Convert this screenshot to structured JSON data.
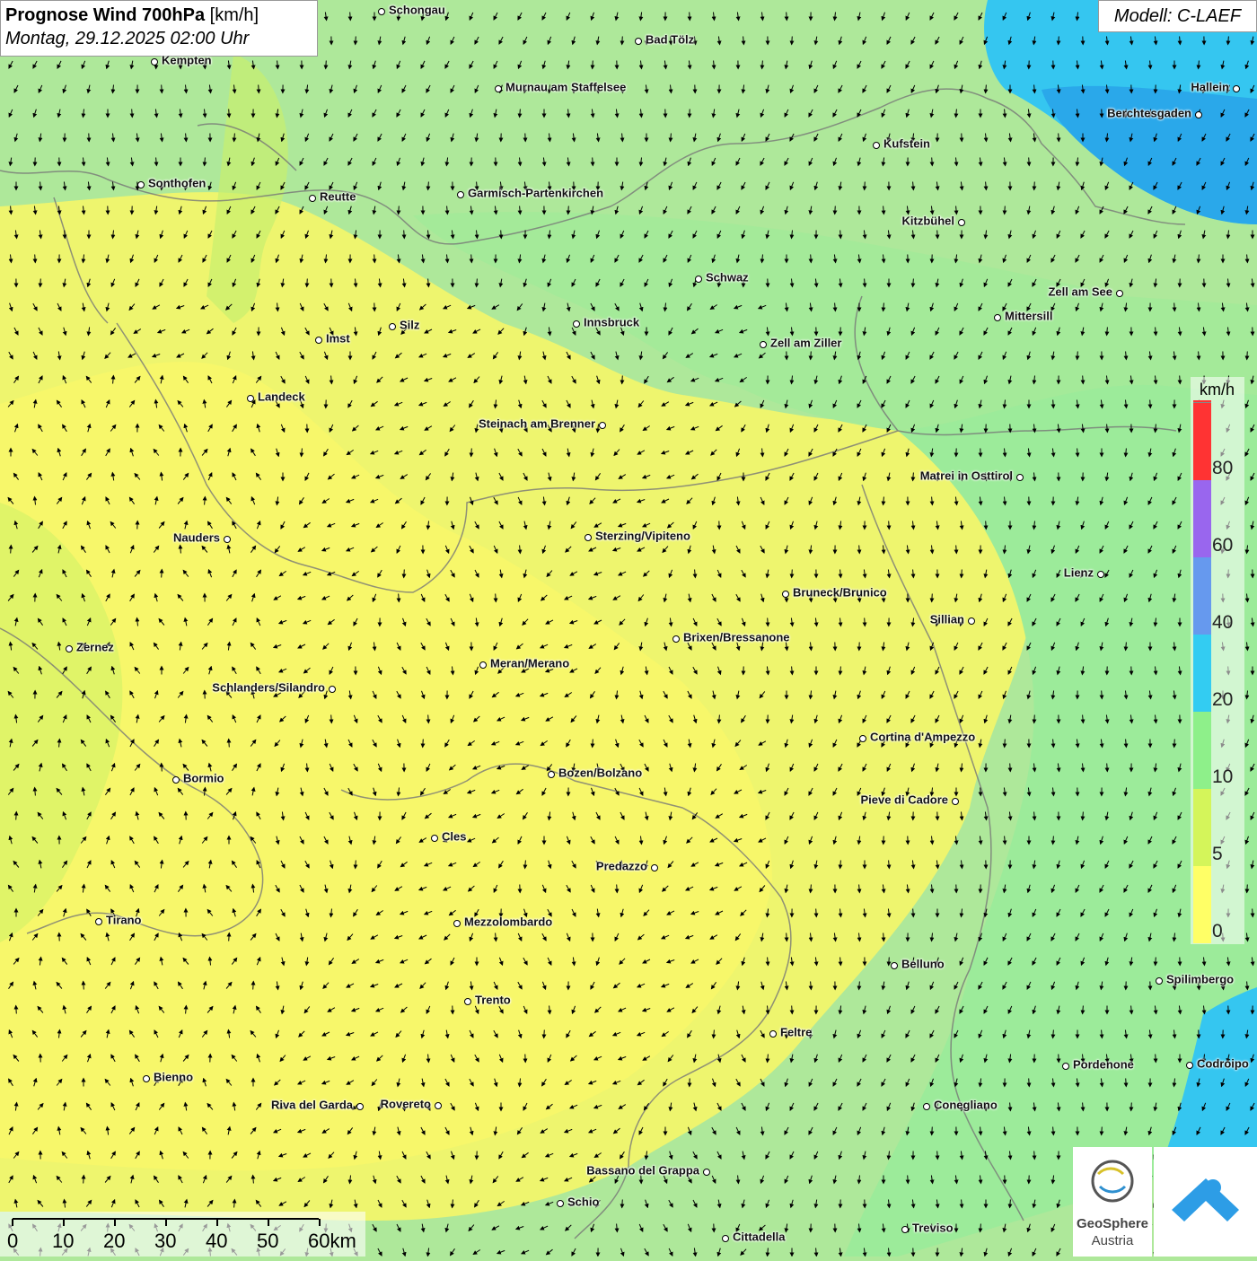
{
  "title": {
    "main": "Prognose Wind 700hPa",
    "unit": "[km/h]",
    "datetime": "Montag, 29.12.2025 02:00 Uhr"
  },
  "model": "Modell: C-LAEF",
  "legend": {
    "unit": "km/h",
    "levels": [
      {
        "label": "0",
        "color": "#ffff66"
      },
      {
        "label": "5",
        "color": "#d4f55a"
      },
      {
        "label": "10",
        "color": "#8ef08a"
      },
      {
        "label": "20",
        "color": "#33ccf2"
      },
      {
        "label": "40",
        "color": "#6699ee"
      },
      {
        "label": "60",
        "color": "#9966ee"
      },
      {
        "label": "80",
        "color": "#ff3333"
      }
    ]
  },
  "scale": {
    "labels": [
      "0",
      "10",
      "20",
      "30",
      "40",
      "50",
      "60km"
    ]
  },
  "logos": {
    "geosphere_line1": "GeoSphere",
    "geosphere_line2": "Austria"
  },
  "cities": [
    {
      "name": "Schongau"
    },
    {
      "name": "Bad Tölz"
    },
    {
      "name": "Kempten"
    },
    {
      "name": "Murnau am Staffelsee"
    },
    {
      "name": "Hallein"
    },
    {
      "name": "Berchtesgaden"
    },
    {
      "name": "Kufstein"
    },
    {
      "name": "Sonthofen"
    },
    {
      "name": "Reutte"
    },
    {
      "name": "Garmisch-Partenkirchen"
    },
    {
      "name": "Kitzbühel"
    },
    {
      "name": "Schwaz"
    },
    {
      "name": "Zell am See"
    },
    {
      "name": "Mittersill"
    },
    {
      "name": "Imst"
    },
    {
      "name": "Silz"
    },
    {
      "name": "Innsbruck"
    },
    {
      "name": "Zell am Ziller"
    },
    {
      "name": "Landeck"
    },
    {
      "name": "Steinach am Brenner"
    },
    {
      "name": "Matrei in Osttirol"
    },
    {
      "name": "Nauders"
    },
    {
      "name": "Sterzing/Vipiteno"
    },
    {
      "name": "Lienz"
    },
    {
      "name": "Bruneck/Brunico"
    },
    {
      "name": "Sillian"
    },
    {
      "name": "Zernez"
    },
    {
      "name": "Brixen/Bressanone"
    },
    {
      "name": "Meran/Merano"
    },
    {
      "name": "Schlanders/Silandro"
    },
    {
      "name": "Cortina d'Ampezzo"
    },
    {
      "name": "Bozen/Bolzano"
    },
    {
      "name": "Bormio"
    },
    {
      "name": "Pieve di Cadore"
    },
    {
      "name": "Cles"
    },
    {
      "name": "Predazzo"
    },
    {
      "name": "Tirano"
    },
    {
      "name": "Mezzolombardo"
    },
    {
      "name": "Belluno"
    },
    {
      "name": "Spilimbergo"
    },
    {
      "name": "Trento"
    },
    {
      "name": "Feltre"
    },
    {
      "name": "Pordenone"
    },
    {
      "name": "Codroipo"
    },
    {
      "name": "Bienno"
    },
    {
      "name": "Riva del Garda"
    },
    {
      "name": "Rovereto"
    },
    {
      "name": "Conegliano"
    },
    {
      "name": "Bassano del Grappa"
    },
    {
      "name": "Schio"
    },
    {
      "name": "Treviso"
    },
    {
      "name": "Cittadella"
    }
  ]
}
